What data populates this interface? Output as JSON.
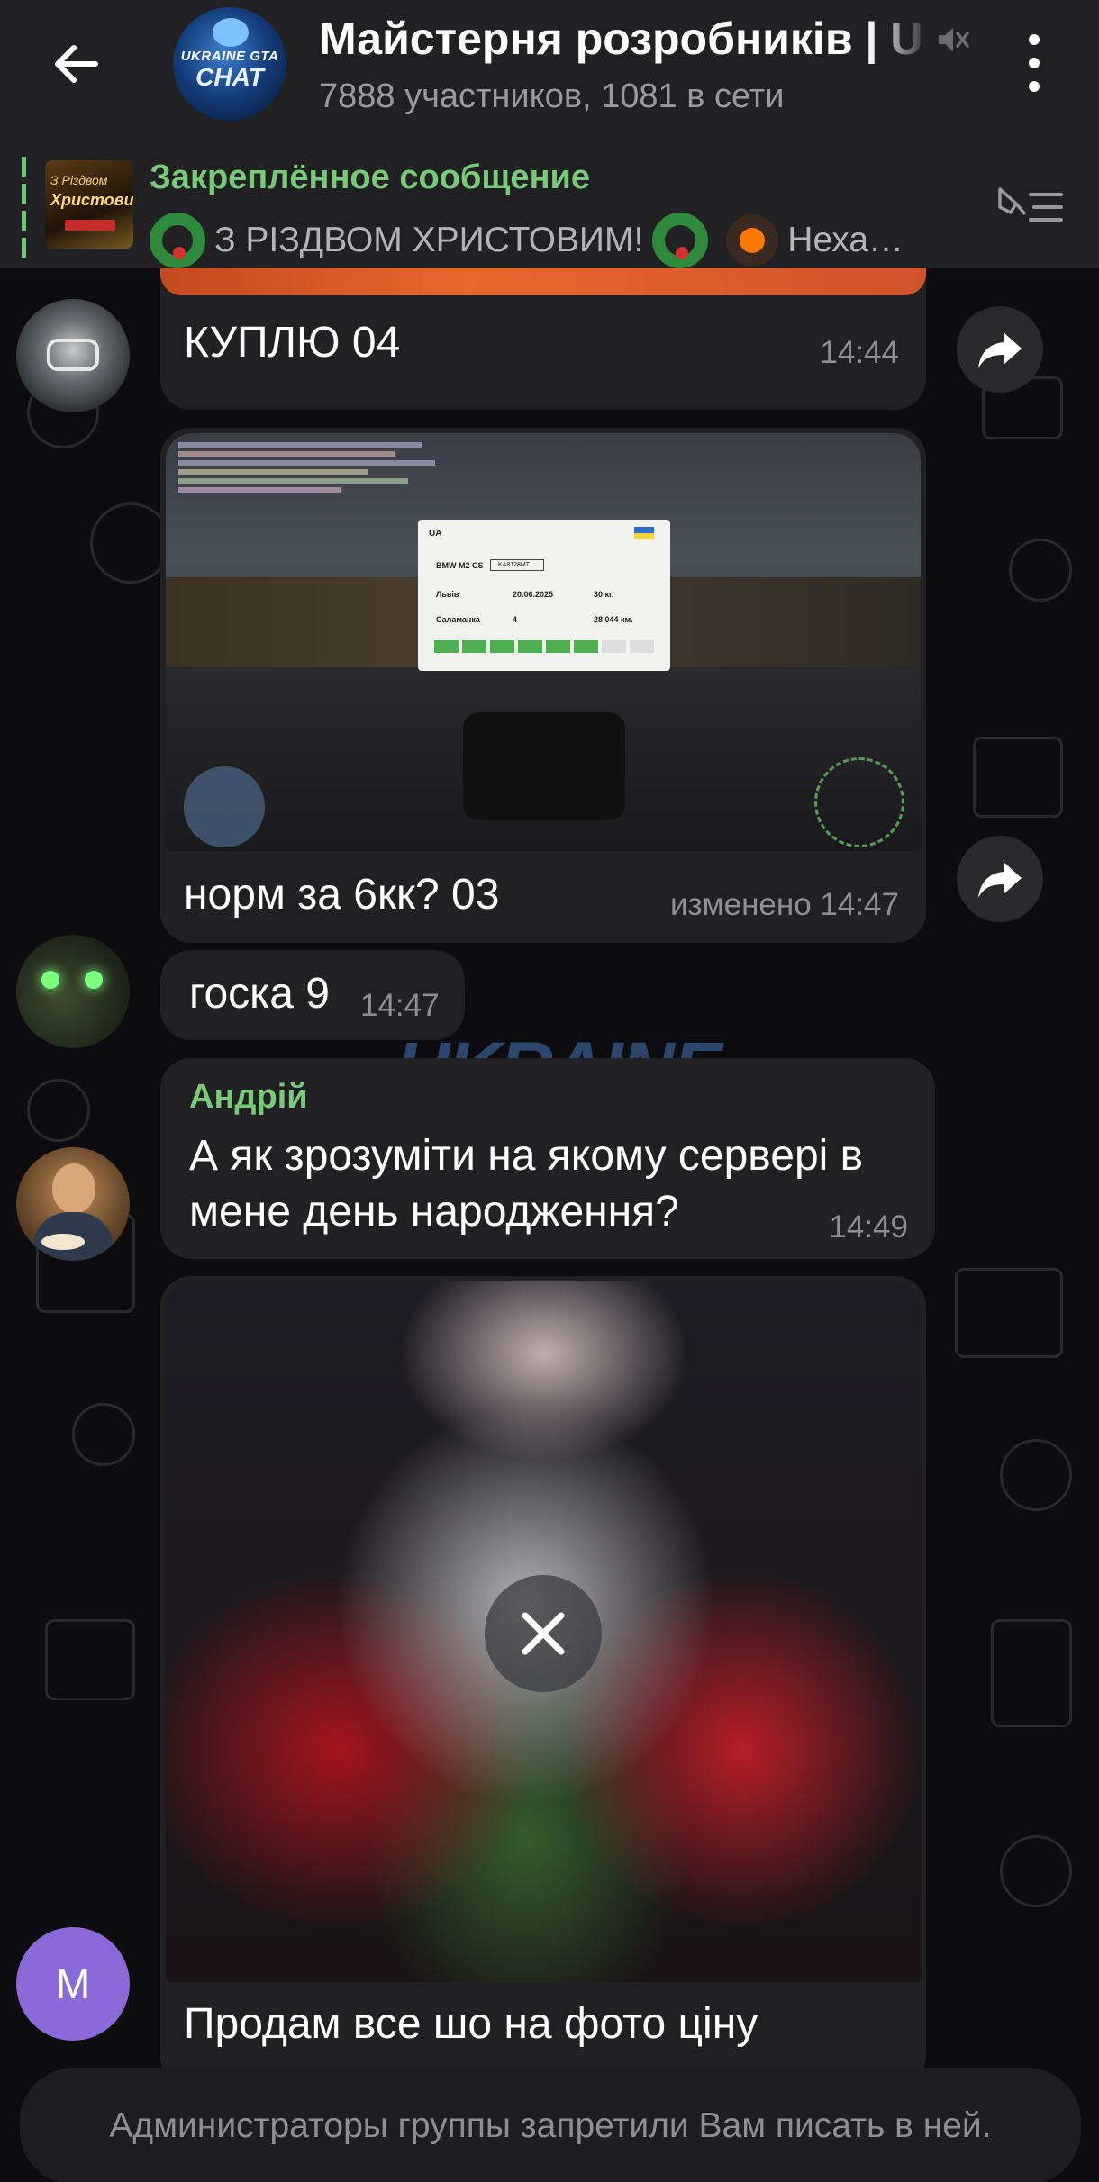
{
  "header": {
    "title": "Майстерня розробників | U",
    "subtitle": "7888 участников, 1081 в сети",
    "avatar_logo_top": "UKRAINE GTA",
    "avatar_logo_bottom": "CHAT",
    "back_icon": "arrow-left-icon",
    "mute_icon": "muted-speaker-icon",
    "menu_icon": "more-vertical-icon"
  },
  "pinned": {
    "title": "Закреплённое сообщение",
    "text_main": "З РІЗДВОМ ХРИСТОВИМ!",
    "text_tail": "Неха…",
    "thumb_line1": "З Різдвом",
    "thumb_line2": "Христовим!",
    "unpin_icon": "unpin-list-icon",
    "accent": "#79c97a"
  },
  "messages": [
    {
      "text": "КУПЛЮ 04",
      "time": "14:44"
    },
    {
      "text": "норм за 6кк? 03",
      "time": "изменено 14:47"
    },
    {
      "text": "госка 9",
      "time": "14:47"
    },
    {
      "sender": "Андрій",
      "text": "А як зрозуміти на якому сервері в мене день народження?",
      "time": "14:49",
      "sender_color": "#79c97a"
    },
    {
      "text": "Продам все шо на фото ціну"
    }
  ],
  "screenshot_card": {
    "plate": "UA",
    "car": "BMW M2 CS",
    "plate_number": "KA8128MT",
    "city": "Львів",
    "date": "20.06.2025",
    "weight": "30 кг.",
    "owner": "Саламанка",
    "seats": "4",
    "mileage": "28 044 км."
  },
  "avatar_letter": "M",
  "bottom_notice": "Администраторы группы запретили Вам писать в ней.",
  "colors": {
    "background": "#0d0d0f",
    "header": "#212123",
    "bubble": "#212123",
    "muted_text": "#8e8e93",
    "avatar_m": "#8a6ad8"
  }
}
